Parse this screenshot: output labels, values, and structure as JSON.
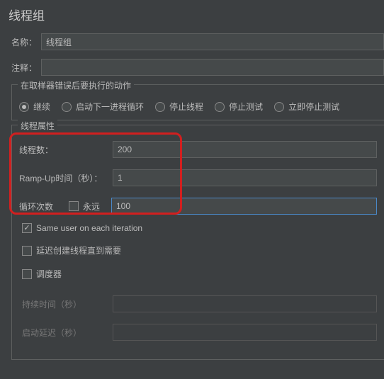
{
  "panel": {
    "title": "线程组"
  },
  "fields": {
    "name_label": "名称：",
    "name_value": "线程组",
    "comment_label": "注释：",
    "comment_value": ""
  },
  "samplerError": {
    "group_title": "在取样器错误后要执行的动作",
    "options": {
      "continue": "继续",
      "start_next": "启动下一进程循环",
      "stop_thread": "停止线程",
      "stop_test": "停止测试",
      "stop_test_now": "立即停止测试"
    },
    "selected": "continue"
  },
  "threadProps": {
    "group_title": "线程属性",
    "threads_label": "线程数：",
    "threads_value": "200",
    "rampup_label": "Ramp-Up时间（秒）：",
    "rampup_value": "1",
    "loop_label": "循环次数",
    "forever_label": "永远",
    "loop_value": "100",
    "same_user_label": "Same user on each iteration",
    "delay_create_label": "延迟创建线程直到需要",
    "scheduler_label": "调度器",
    "duration_label": "持续时间（秒）",
    "startup_delay_label": "启动延迟（秒）"
  }
}
